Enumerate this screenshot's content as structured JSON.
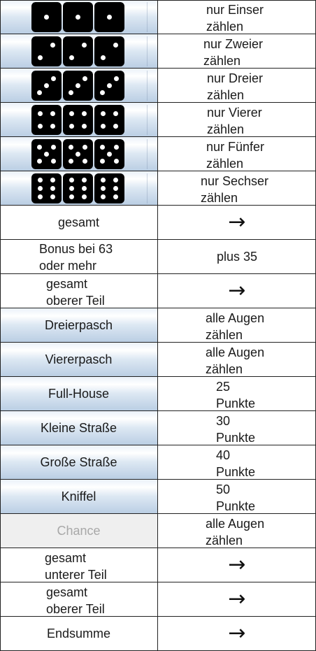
{
  "upper_rows": [
    {
      "die_value": 1,
      "dice_icon": "dice-one-icon",
      "line1": "nur Einser",
      "line2": "zählen"
    },
    {
      "die_value": 2,
      "dice_icon": "dice-two-icon",
      "line1": "nur Zweier",
      "line2": "zählen"
    },
    {
      "die_value": 3,
      "dice_icon": "dice-three-icon",
      "line1": "nur Dreier",
      "line2": "zählen"
    },
    {
      "die_value": 4,
      "dice_icon": "dice-four-icon",
      "line1": "nur Vierer",
      "line2": "zählen"
    },
    {
      "die_value": 5,
      "dice_icon": "dice-five-icon",
      "line1": "nur Fünfer",
      "line2": "zählen"
    },
    {
      "die_value": 6,
      "dice_icon": "dice-six-icon",
      "line1": "nur Sechser",
      "line2": "zählen"
    }
  ],
  "upper_total": {
    "label": "gesamt",
    "arrow": "→"
  },
  "bonus": {
    "line1": "Bonus bei 63",
    "line2": "oder mehr",
    "value": "plus 35"
  },
  "upper_total_2": {
    "line1": "gesamt",
    "line2": "oberer Teil",
    "arrow": "→"
  },
  "lower_rows": [
    {
      "label": "Dreierpasch",
      "line1": "alle Augen",
      "line2": "zählen",
      "enabled": true
    },
    {
      "label": "Viererpasch",
      "line1": "alle Augen",
      "line2": "zählen",
      "enabled": true
    },
    {
      "label": "Full-House",
      "line1": "25",
      "line2": "Punkte",
      "enabled": true
    },
    {
      "label": "Kleine Straße",
      "line1": "30",
      "line2": "Punkte",
      "enabled": true
    },
    {
      "label": "Große Straße",
      "line1": "40",
      "line2": "Punkte",
      "enabled": true
    },
    {
      "label": "Kniffel",
      "line1": "50",
      "line2": "Punkte",
      "enabled": true
    },
    {
      "label": "Chance",
      "line1": "alle Augen",
      "line2": "zählen",
      "enabled": false
    }
  ],
  "lower_total": {
    "line1": "gesamt",
    "line2": "unterer Teil",
    "arrow": "→"
  },
  "upper_total_3": {
    "line1": "gesamt",
    "line2": "oberer Teil",
    "arrow": "→"
  },
  "grand_total": {
    "label": "Endsumme",
    "arrow": "→"
  },
  "colors": {
    "grid": "#222222",
    "button_gradient_top": "#eaf1f9",
    "button_gradient_bottom": "#b9cde3",
    "disabled_bg": "#efefef",
    "disabled_text": "#a8a8a8",
    "die": "#000000",
    "pip": "#ffffff"
  }
}
